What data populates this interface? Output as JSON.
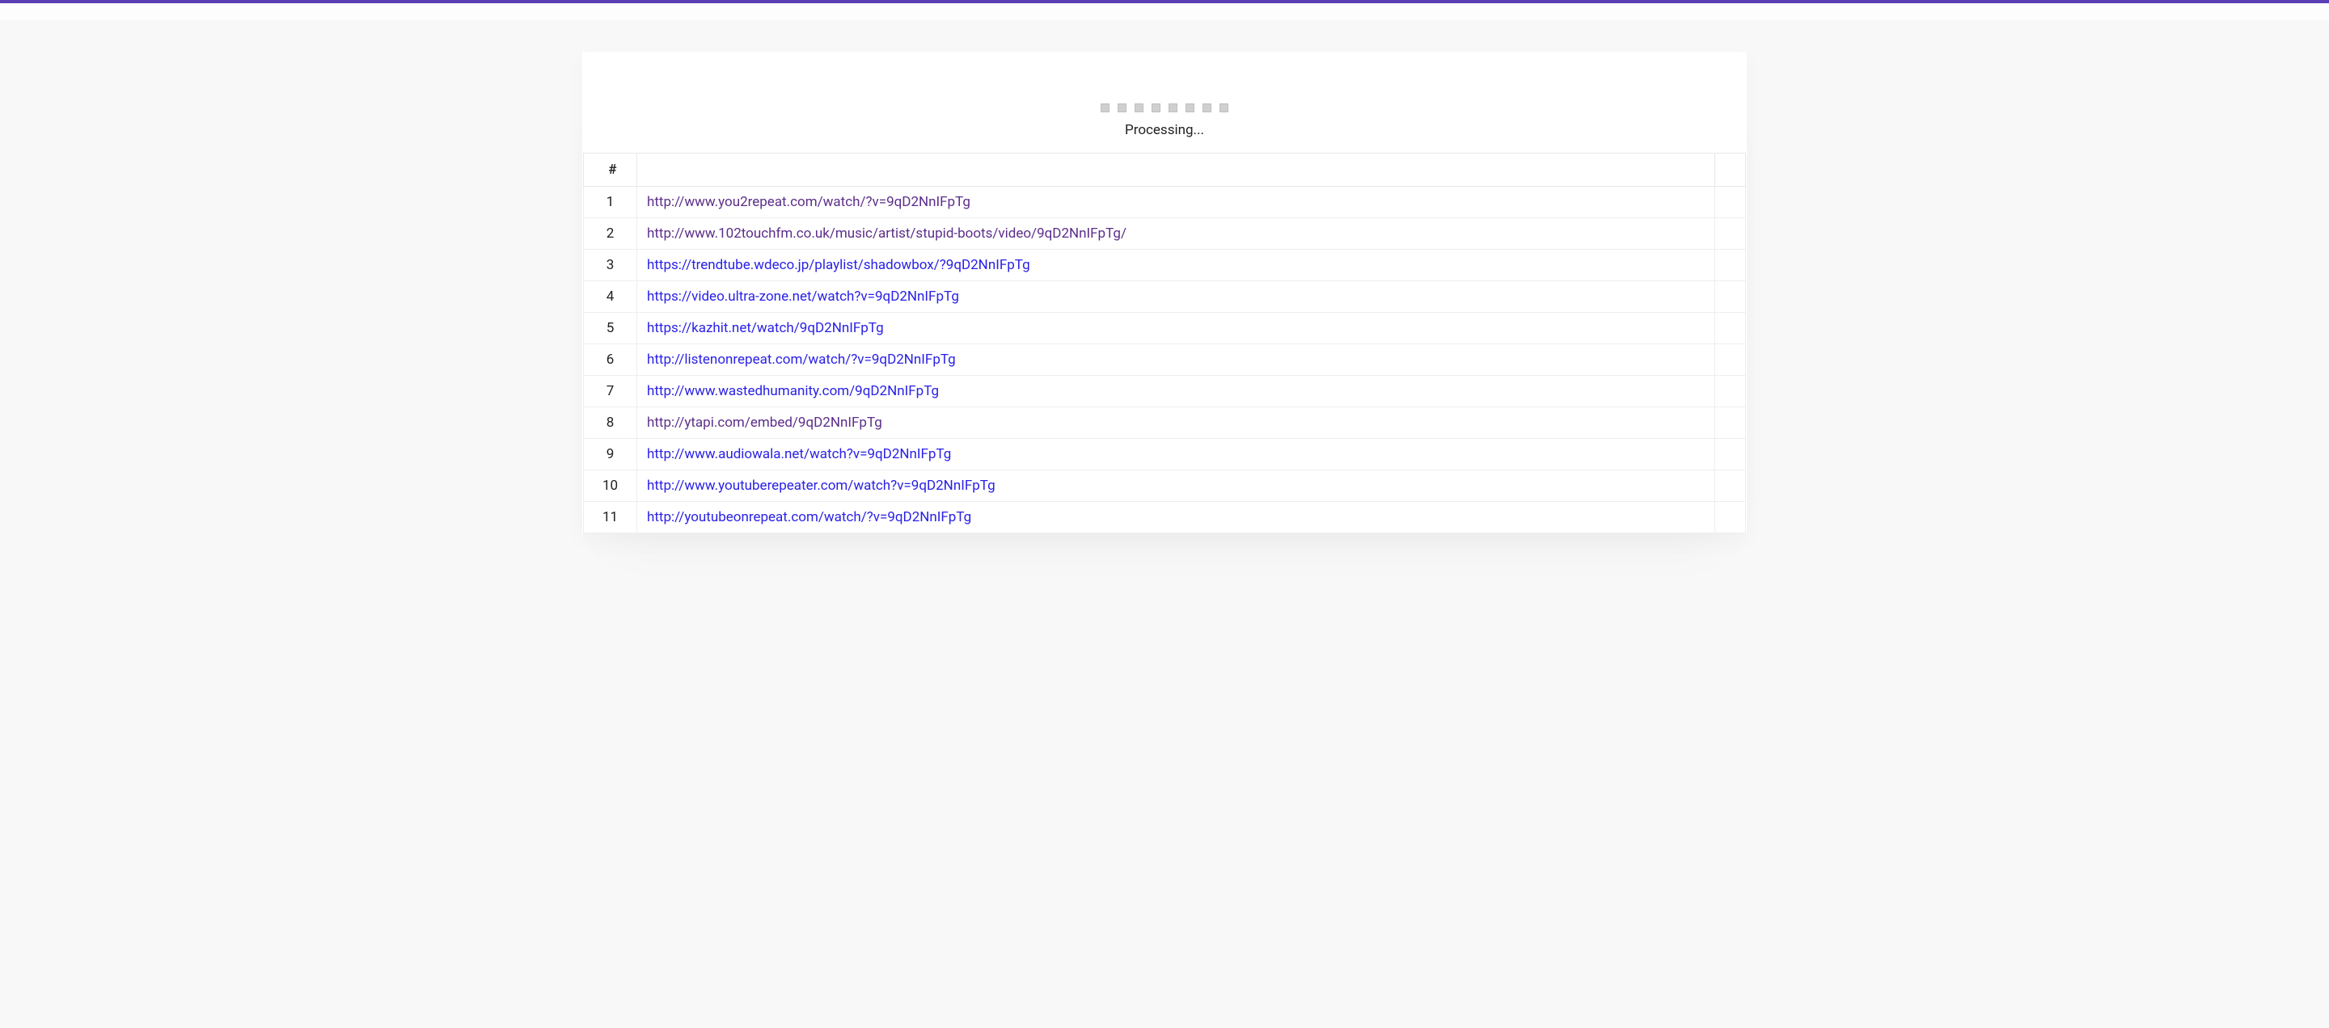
{
  "status": {
    "text": "Processing..."
  },
  "table": {
    "header": {
      "index_label": "#",
      "url_label": "",
      "actions_label": ""
    },
    "rows": [
      {
        "n": "1",
        "url": "http://www.you2repeat.com/watch/?v=9qD2NnIFpTg",
        "visited": true
      },
      {
        "n": "2",
        "url": "http://www.102touchfm.co.uk/music/artist/stupid-boots/video/9qD2NnIFpTg/",
        "visited": true
      },
      {
        "n": "3",
        "url": "https://trendtube.wdeco.jp/playlist/shadowbox/?9qD2NnIFpTg",
        "visited": false
      },
      {
        "n": "4",
        "url": "https://video.ultra-zone.net/watch?v=9qD2NnIFpTg",
        "visited": false
      },
      {
        "n": "5",
        "url": "https://kazhit.net/watch/9qD2NnIFpTg",
        "visited": false
      },
      {
        "n": "6",
        "url": "http://listenonrepeat.com/watch/?v=9qD2NnIFpTg",
        "visited": false
      },
      {
        "n": "7",
        "url": "http://www.wastedhumanity.com/9qD2NnIFpTg",
        "visited": false
      },
      {
        "n": "8",
        "url": "http://ytapi.com/embed/9qD2NnIFpTg",
        "visited": true
      },
      {
        "n": "9",
        "url": "http://www.audiowala.net/watch?v=9qD2NnIFpTg",
        "visited": false
      },
      {
        "n": "10",
        "url": "http://www.youtuberepeater.com/watch?v=9qD2NnIFpTg",
        "visited": false
      },
      {
        "n": "11",
        "url": "http://youtubeonrepeat.com/watch/?v=9qD2NnIFpTg",
        "visited": false
      }
    ]
  },
  "colors": {
    "accent": "#5a3fb5",
    "link": "#2a21e6",
    "link_visited": "#5c2e8a"
  }
}
